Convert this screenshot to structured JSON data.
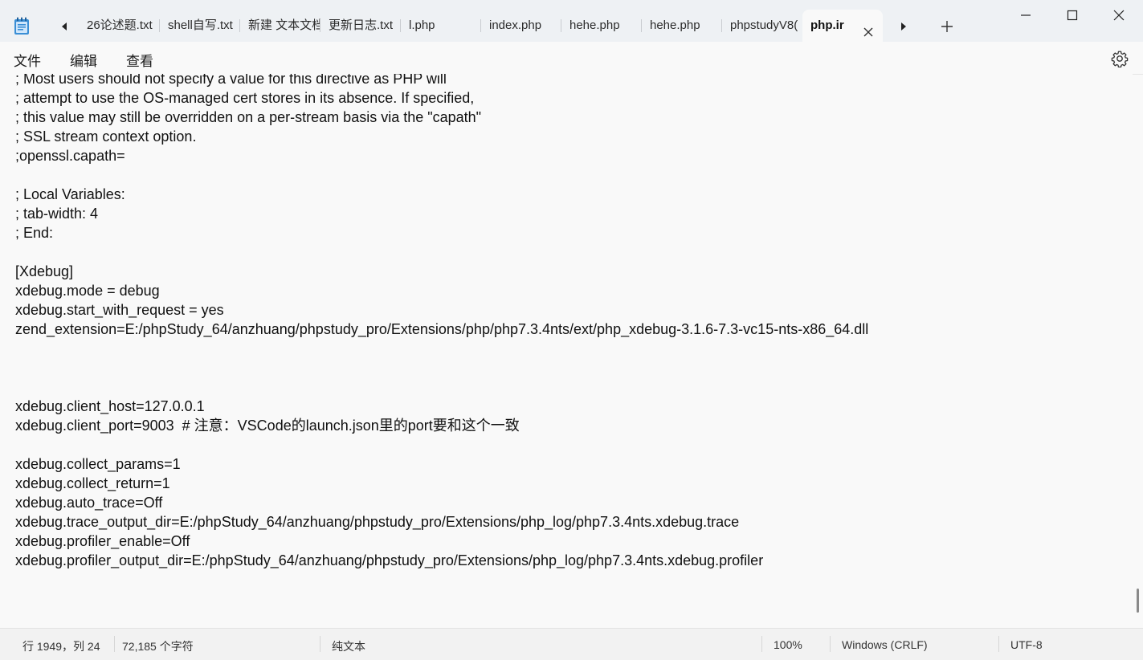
{
  "tabs": [
    {
      "label": "26论述题.txt",
      "active": false
    },
    {
      "label": "shell自写.txt",
      "active": false
    },
    {
      "label": "新建 文本文档",
      "active": false
    },
    {
      "label": "更新日志.txt",
      "active": false
    },
    {
      "label": "l.php",
      "active": false
    },
    {
      "label": "index.php",
      "active": false
    },
    {
      "label": "hehe.php",
      "active": false
    },
    {
      "label": "hehe.php",
      "active": false
    },
    {
      "label": "phpstudyV8(",
      "active": false
    },
    {
      "label": "php.ir",
      "active": true
    }
  ],
  "menu": {
    "file": "文件",
    "edit": "编辑",
    "view": "查看"
  },
  "editor": {
    "lines": [
      "; Most users should not specify a value for this directive as PHP will",
      "; attempt to use the OS-managed cert stores in its absence. If specified,",
      "; this value may still be overridden on a per-stream basis via the \"capath\"",
      "; SSL stream context option.",
      ";openssl.capath=",
      "",
      "; Local Variables:",
      "; tab-width: 4",
      "; End:",
      "",
      "[Xdebug]",
      "xdebug.mode = debug",
      "xdebug.start_with_request = yes",
      "zend_extension=E:/phpStudy_64/anzhuang/phpstudy_pro/Extensions/php/php7.3.4nts/ext/php_xdebug-3.1.6-7.3-vc15-nts-x86_64.dll",
      "",
      "",
      "",
      "xdebug.client_host=127.0.0.1",
      "xdebug.client_port=9003  # 注意：VSCode的launch.json里的port要和这个一致",
      "",
      "xdebug.collect_params=1",
      "xdebug.collect_return=1",
      "xdebug.auto_trace=Off",
      "xdebug.trace_output_dir=E:/phpStudy_64/anzhuang/phpstudy_pro/Extensions/php_log/php7.3.4nts.xdebug.trace",
      "xdebug.profiler_enable=Off",
      "xdebug.profiler_output_dir=E:/phpStudy_64/anzhuang/phpstudy_pro/Extensions/php_log/php7.3.4nts.xdebug.profiler"
    ]
  },
  "status": {
    "position": "行 1949，列 24",
    "char_count": "72,185 个字符",
    "format": "纯文本",
    "zoom": "100%",
    "line_ending": "Windows (CRLF)",
    "encoding": "UTF-8"
  },
  "colors": {
    "accent": "#0078d4",
    "titlebar_bg": "#eef1f4",
    "editor_bg": "#f9f9f9"
  }
}
